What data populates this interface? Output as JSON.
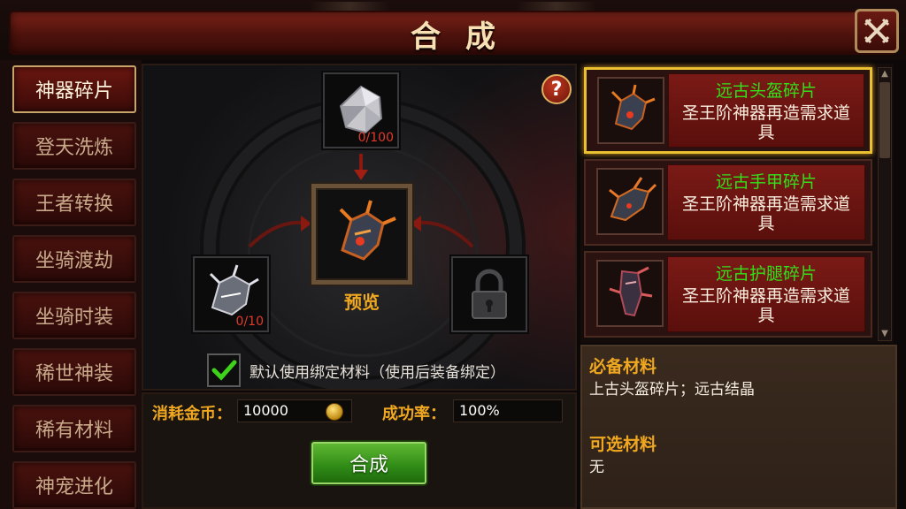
{
  "header": {
    "title": "合成"
  },
  "sidebar": {
    "items": [
      {
        "label": "神器碎片",
        "active": true
      },
      {
        "label": "登天洗炼",
        "active": false
      },
      {
        "label": "王者转换",
        "active": false
      },
      {
        "label": "坐骑渡劫",
        "active": false
      },
      {
        "label": "坐骑时装",
        "active": false
      },
      {
        "label": "稀世神装",
        "active": false
      },
      {
        "label": "稀有材料",
        "active": false
      },
      {
        "label": "神宠进化",
        "active": false
      }
    ]
  },
  "craft": {
    "help_label": "?",
    "top_slot": {
      "icon": "crystal-icon",
      "count": "0/100"
    },
    "left_slot": {
      "icon": "helmet-fragment-icon",
      "count": "0/10"
    },
    "right_slot": {
      "icon": "lock-icon"
    },
    "center_slot": {
      "icon": "helmet-icon"
    },
    "preview_label": "预览",
    "bind_checkbox": {
      "checked": true,
      "label": "默认使用绑定材料（使用后装备绑定）"
    }
  },
  "cost": {
    "gold_label": "消耗金币：",
    "gold_value": "10000",
    "rate_label": "成功率：",
    "rate_value": "100%",
    "craft_button": "合成"
  },
  "list": {
    "items": [
      {
        "name": "远古头盔碎片",
        "desc": "圣王阶神器再造需求道具",
        "selected": true,
        "icon": "helmet-icon"
      },
      {
        "name": "远古手甲碎片",
        "desc": "圣王阶神器再造需求道具",
        "selected": false,
        "icon": "gauntlet-icon"
      },
      {
        "name": "远古护腿碎片",
        "desc": "圣王阶神器再造需求道具",
        "selected": false,
        "icon": "legguard-icon"
      }
    ]
  },
  "materials": {
    "required_title": "必备材料",
    "required_text": "上古头盔碎片；远古结晶",
    "optional_title": "可选材料",
    "optional_text": "无"
  },
  "colors": {
    "accent_gold": "#f0a820",
    "name_green": "#33e01a",
    "count_red": "#e23a2a",
    "button_green": "#2f8a16"
  }
}
